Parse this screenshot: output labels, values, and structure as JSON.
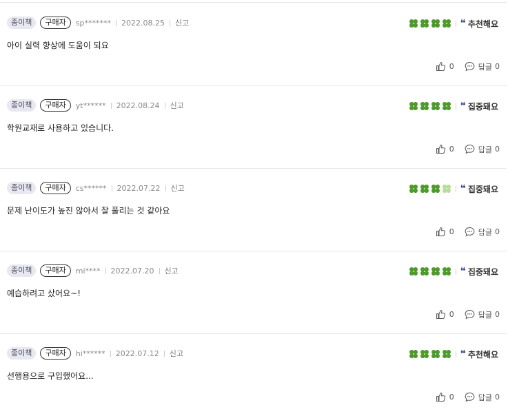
{
  "colors": {
    "clover_full": "#4e9a2a",
    "clover_light": "#b8dc9c",
    "accent": "#3a4a8e"
  },
  "labels": {
    "report": "신고",
    "reply": "답글"
  },
  "reviews": [
    {
      "format": "종이책",
      "buyer": "구매자",
      "user": "sp*******",
      "date": "2022.08.25",
      "rating": 4,
      "tag": "추천해요",
      "content": "아이 실력 향상에 도움이 되요",
      "likes": "0",
      "replies": "0"
    },
    {
      "format": "종이책",
      "buyer": "구매자",
      "user": "yt******",
      "date": "2022.08.24",
      "rating": 4,
      "tag": "집중돼요",
      "content": "학원교재로 사용하고 있습니다.",
      "likes": "0",
      "replies": "0"
    },
    {
      "format": "종이책",
      "buyer": "구매자",
      "user": "cs******",
      "date": "2022.07.22",
      "rating": 3,
      "tag": "집중돼요",
      "content": "문제 난이도가 높진 않아서 잘 풀리는 것 같아요",
      "likes": "0",
      "replies": "0"
    },
    {
      "format": "종이책",
      "buyer": "구매자",
      "user": "mi****",
      "date": "2022.07.20",
      "rating": 4,
      "tag": "집중돼요",
      "content": "예습하려고 샀어요~!",
      "likes": "0",
      "replies": "0"
    },
    {
      "format": "종이책",
      "buyer": "구매자",
      "user": "hi******",
      "date": "2022.07.12",
      "rating": 4,
      "tag": "추천해요",
      "content": "선행용으로 구입했어요...",
      "likes": "0",
      "replies": "0"
    }
  ]
}
